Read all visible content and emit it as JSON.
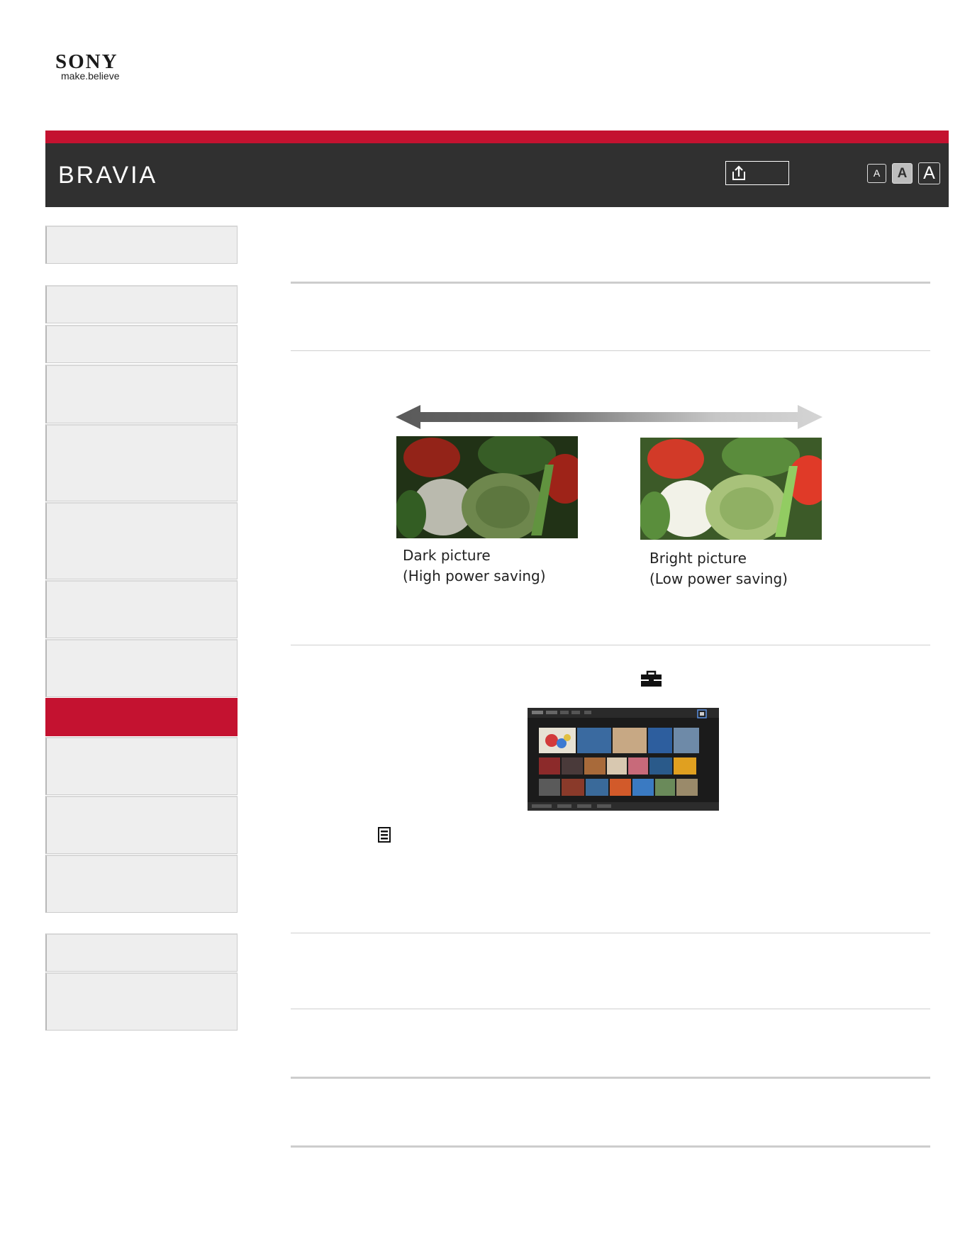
{
  "brand": {
    "logo_text": "SONY",
    "logo_tagline": "make.believe",
    "product_name": "BRAVIA"
  },
  "header": {
    "share_icon": "share-upload-icon",
    "font_size_buttons": [
      {
        "label": "A",
        "size": "small"
      },
      {
        "label": "A",
        "size": "medium",
        "selected": true
      },
      {
        "label": "A",
        "size": "large"
      }
    ]
  },
  "sidebar": {
    "items": [
      {
        "label": ""
      },
      {
        "label": ""
      },
      {
        "label": ""
      },
      {
        "label": ""
      },
      {
        "label": ""
      },
      {
        "label": ""
      },
      {
        "label": ""
      },
      {
        "label": ""
      },
      {
        "label": "",
        "active": true
      },
      {
        "label": ""
      },
      {
        "label": ""
      },
      {
        "label": ""
      },
      {
        "label": ""
      },
      {
        "label": ""
      }
    ]
  },
  "figure": {
    "dark_caption_line1": "Dark picture",
    "dark_caption_line2": "(High power saving)",
    "bright_caption_line1": "Bright picture",
    "bright_caption_line2": "(Low power saving)"
  },
  "icons": {
    "toolbox": "toolbox-icon",
    "options": "options-list-icon"
  },
  "colors": {
    "accent": "#c41230",
    "header_bg": "#303030",
    "sidebar_bg": "#eeeeee",
    "highlight_frame": "#5b8fe0"
  }
}
